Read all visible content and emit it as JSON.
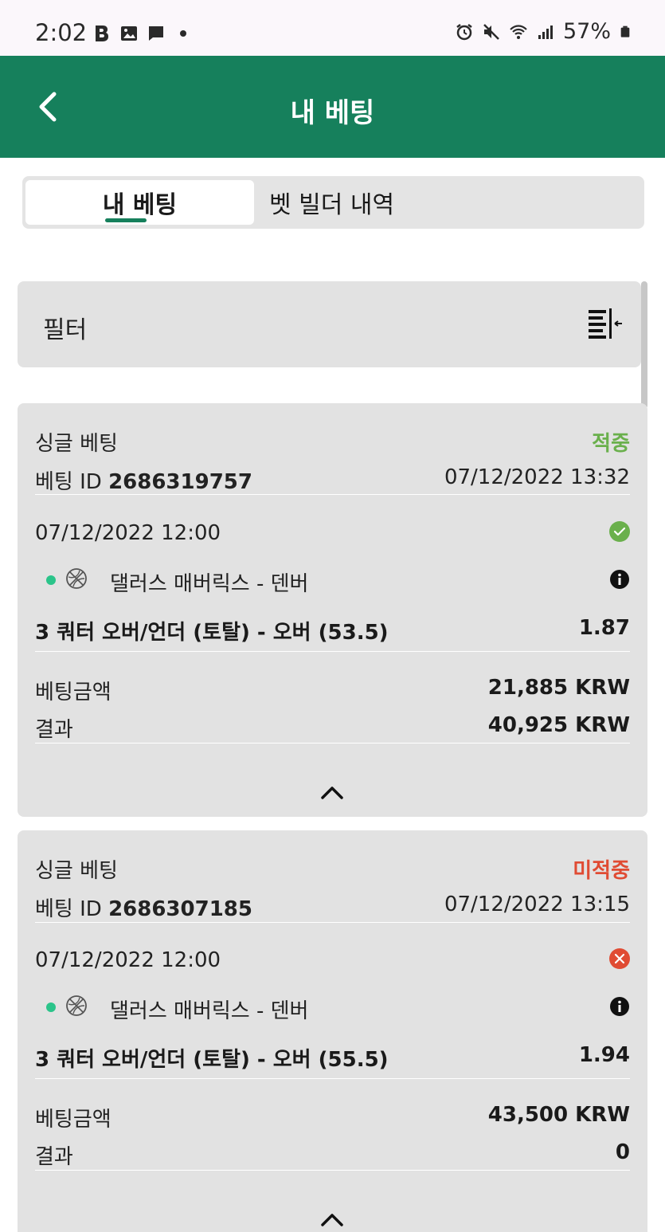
{
  "status_bar": {
    "time": "2:02",
    "battery": "57%"
  },
  "app_bar": {
    "title": "내 베팅"
  },
  "tabs": [
    {
      "label": "내 베팅",
      "active": true
    },
    {
      "label": "벳 빌더 내역",
      "active": false
    }
  ],
  "filter": {
    "label": "필터"
  },
  "bets": [
    {
      "type": "싱글 베팅",
      "status": "적중",
      "id_label": "베팅 ID",
      "id": "2686319757",
      "placed_at": "07/12/2022 13:32",
      "event_date": "07/12/2022 12:00",
      "event_name": "댈러스 매버릭스 - 덴버",
      "selection": "3 쿼터 오버/언더 (토탈) - 오버 (53.5)",
      "odds": "1.87",
      "stake_label": "베팅금액",
      "stake": "21,885 KRW",
      "result_label": "결과",
      "result": "40,925 KRW"
    },
    {
      "type": "싱글 베팅",
      "status": "미적중",
      "id_label": "베팅 ID",
      "id": "2686307185",
      "placed_at": "07/12/2022 13:15",
      "event_date": "07/12/2022 12:00",
      "event_name": "댈러스 매버릭스 - 덴버",
      "selection": "3 쿼터 오버/언더 (토탈) - 오버 (55.5)",
      "odds": "1.94",
      "stake_label": "베팅금액",
      "stake": "43,500 KRW",
      "result_label": "결과",
      "result": "0"
    }
  ],
  "colors": {
    "brand_green": "#16805c",
    "won": "#6ab04c",
    "lost": "#e04b33",
    "live_dot": "#2bc48a"
  },
  "icons": {
    "back": "chevron-left-icon",
    "filter": "filter-icon",
    "won": "check-circle-icon",
    "lost": "x-circle-icon",
    "sport": "basketball-icon",
    "info": "info-icon",
    "collapse": "chevron-up-icon"
  }
}
